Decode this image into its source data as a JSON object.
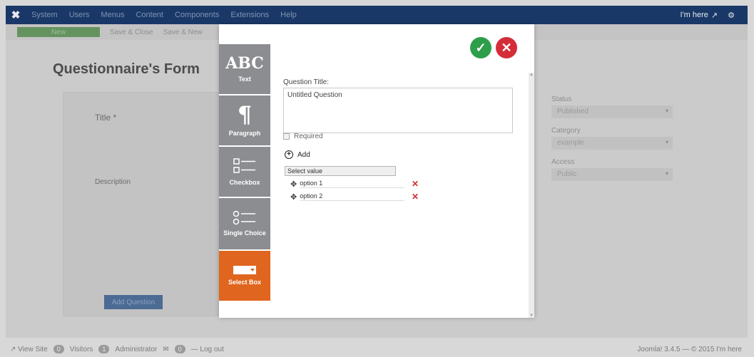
{
  "navbar": {
    "menu": [
      "System",
      "Users",
      "Menus",
      "Content",
      "Components",
      "Extensions",
      "Help"
    ],
    "user_label": "I'm here"
  },
  "toolbar": {
    "new_label": "New",
    "save_close_label": "Save & Close",
    "save_new_label": "Save & New"
  },
  "page": {
    "form_title": "Questionnaire's Form",
    "title_label": "Title *",
    "description_label": "Description",
    "add_question_label": "Add Question"
  },
  "side": {
    "status_label": "Status",
    "status_value": "Published",
    "category_label": "Category",
    "category_value": "example",
    "access_label": "Access",
    "access_value": "Public"
  },
  "modal": {
    "tools": [
      {
        "glyph": "ABC",
        "label": "Text"
      },
      {
        "glyph": "¶",
        "label": "Paragraph"
      },
      {
        "glyph": "",
        "label": "Checkbox"
      },
      {
        "glyph": "",
        "label": "Single Choice"
      },
      {
        "glyph": "",
        "label": "Select Box"
      }
    ],
    "question_title_label": "Question Title:",
    "question_title_value": "Untitled Question",
    "required_label": "Required",
    "add_label": "Add",
    "select_value": "Select value",
    "options": [
      "option 1",
      "option 2"
    ]
  },
  "statusbar": {
    "view_site": "View Site",
    "visitors_count": "0",
    "visitors_label": "Visitors",
    "admin_count": "1",
    "admin_label": "Administrator",
    "messages_count": "0",
    "logout_label": "Log out",
    "version": "Joomla! 3.4.5 — © 2015 I'm here"
  },
  "colors": {
    "nav_bg": "#1a3867",
    "tool_bg": "#8b8d90",
    "tool_active": "#e0651e",
    "ok": "#2e9e4a",
    "cancel": "#d42d38"
  }
}
